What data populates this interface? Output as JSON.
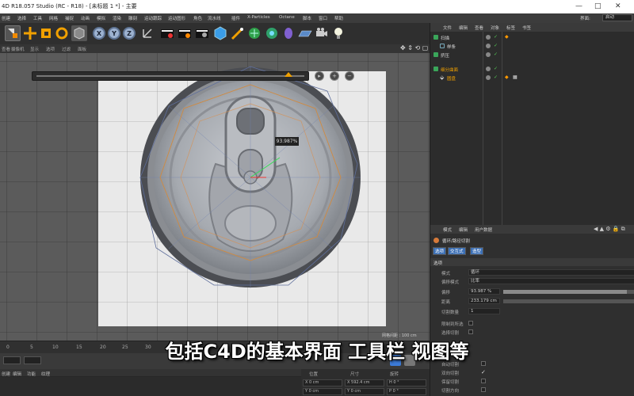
{
  "window": {
    "title": "4D R18.057 Studio (RC - R18) - [未标题 1 *] - 主要",
    "controls": [
      "—",
      "□",
      "✕"
    ]
  },
  "menubar": {
    "items": [
      "创建",
      "选择",
      "工具",
      "网格",
      "捕捉",
      "动画",
      "模拟",
      "渲染",
      "雕刻",
      "运动跟踪",
      "运动图形",
      "角色",
      "流水线",
      "插件",
      "X-Particles",
      "Octane",
      "脚本",
      "窗口",
      "帮助"
    ],
    "layout_label": "界面:",
    "layout_value": "启动"
  },
  "toolbar": {
    "axis_x": "X",
    "axis_y": "Y",
    "axis_z": "Z"
  },
  "viewport_menu": {
    "items": [
      "查看",
      "摄像机",
      "显示",
      "选项",
      "过滤",
      "面板"
    ]
  },
  "viewport": {
    "slider_value_label": "93.987%",
    "slider_fraction": 0.94,
    "projection_label": "网格间距 : 100 cm"
  },
  "subtitle": "包括C4D的基本界面 工具栏 视图等",
  "timeline": {
    "ticks": [
      "0",
      "5",
      "10",
      "15",
      "20",
      "25",
      "30"
    ]
  },
  "materials": {
    "menu": [
      "创建",
      "编辑",
      "功能",
      "纹理"
    ]
  },
  "coordinates": {
    "headers": [
      "位置",
      "尺寸",
      "旋转"
    ],
    "row1": [
      "X  0 cm",
      "X  592.4 cm",
      "H  0 °"
    ],
    "row2": [
      "Y  0 cm",
      "Y  0 cm",
      "P  0 °"
    ]
  },
  "object_manager": {
    "tabs": [
      "文件",
      "编辑",
      "查看",
      "对象",
      "标签",
      "书签"
    ],
    "objects": [
      {
        "name": "扫描",
        "indent": 0
      },
      {
        "name": "样条",
        "indent": 1
      },
      {
        "name": "挤压",
        "indent": 0
      },
      {
        "name": "细分曲面",
        "indent": 0,
        "highlight": true
      },
      {
        "name": "圆盘",
        "indent": 1
      }
    ]
  },
  "attribute_manager": {
    "tabs": [
      "模式",
      "编辑",
      "用户数据"
    ],
    "tool_title": "循环/路径切割",
    "subtabs": [
      "选项",
      "交互式",
      "造型"
    ],
    "section": "选项",
    "fields": [
      {
        "label": "模式",
        "value": "循环"
      },
      {
        "label": "偏移模式",
        "value": "比率"
      },
      {
        "label": "偏移",
        "value": "93.987 %"
      },
      {
        "label": "距离",
        "value": "233.179 cm"
      },
      {
        "label": "切割数量",
        "value": "1"
      }
    ],
    "checks": [
      "限制到所选",
      "选择切割"
    ],
    "lower_checks": [
      "自动切割",
      "双向切割",
      "保留切割",
      "切割方向"
    ]
  }
}
